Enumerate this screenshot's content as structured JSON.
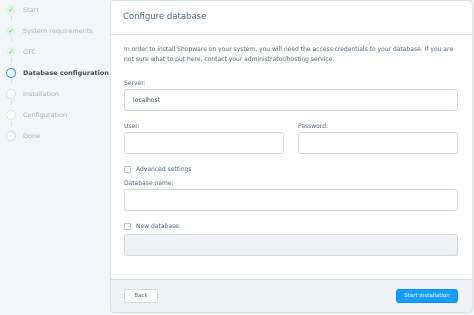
{
  "steps": [
    {
      "label": "Start",
      "state": "done"
    },
    {
      "label": "System requirements",
      "state": "done"
    },
    {
      "label": "GTC",
      "state": "done"
    },
    {
      "label": "Database configuration",
      "state": "active"
    },
    {
      "label": "Installation",
      "state": "todo"
    },
    {
      "label": "Configuration",
      "state": "todo"
    },
    {
      "label": "Done",
      "state": "todo"
    }
  ],
  "card": {
    "title": "Configure database",
    "intro": "In order to install Shopware on your system, you will need the access credentials to your database. If you are not sure what to put here, contact your administrator/hosting service."
  },
  "form": {
    "server_label": "Server:",
    "server_value": "localhost",
    "user_label": "User:",
    "user_value": "",
    "password_label": "Password:",
    "password_value": "",
    "advanced_label": "Advanced settings",
    "advanced_checked": false,
    "dbname_label": "Database name:",
    "dbname_value": "",
    "newdb_label": "New database:",
    "newdb_checked": false,
    "newdb_value": ""
  },
  "footer": {
    "back_label": "Back",
    "start_label": "Start installation"
  },
  "colors": {
    "accent": "#189eff",
    "success": "#37d046",
    "border": "#d9e0e6"
  },
  "icons": {
    "done": "check-icon",
    "active": "active-step-icon",
    "todo": "empty-step-icon"
  }
}
